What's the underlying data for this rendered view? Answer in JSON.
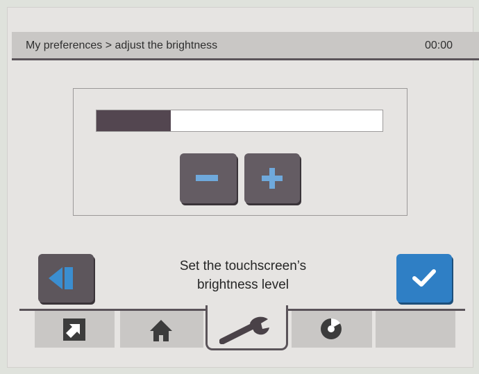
{
  "header": {
    "breadcrumb": "My preferences > adjust the brightness",
    "time": "00:00"
  },
  "brightness": {
    "level": 0.26,
    "decrease_label": "−",
    "increase_label": "+"
  },
  "instruction": {
    "line1": "Set the touchscreen’s",
    "line2": "brightness level"
  },
  "tabs": [
    {
      "icon": "external-arrow-icon",
      "active": false
    },
    {
      "icon": "home-icon",
      "active": false
    },
    {
      "icon": "wrench-icon",
      "active": true
    },
    {
      "icon": "disc-icon",
      "active": false
    },
    {
      "icon": "",
      "active": false
    }
  ],
  "colors": {
    "accent": "#2f7fc5",
    "button_dark": "#645c63",
    "glyph_blue": "#6fa9dc",
    "bar_fill": "#534650"
  }
}
